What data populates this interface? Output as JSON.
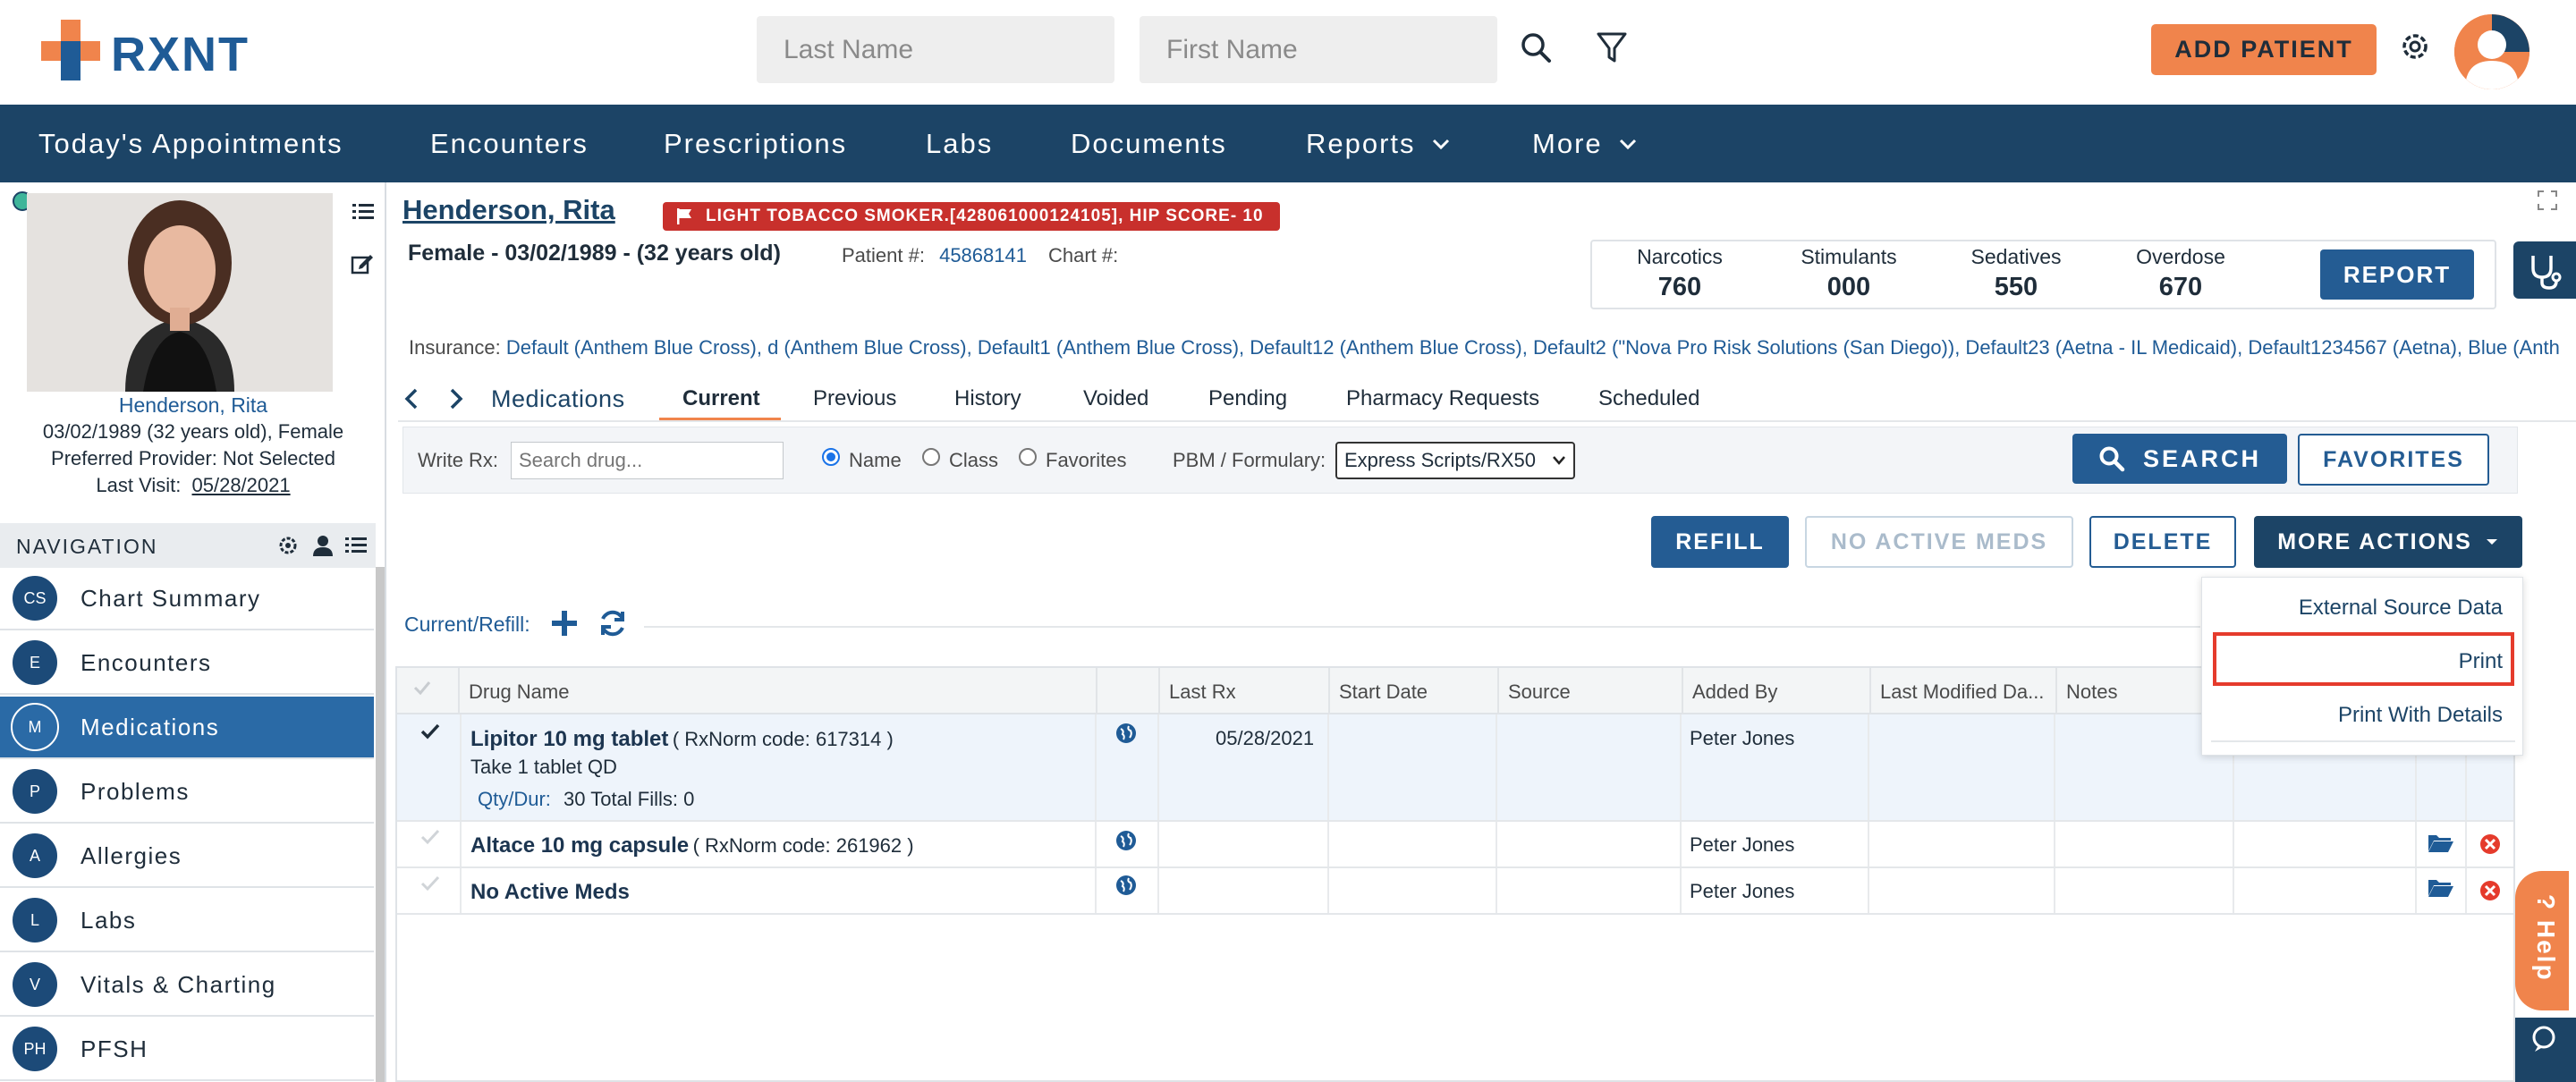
{
  "header": {
    "logo_text": "RXNT",
    "last_name_placeholder": "Last Name",
    "first_name_placeholder": "First Name",
    "add_patient_label": "ADD PATIENT"
  },
  "main_nav": {
    "items": [
      "Today's Appointments",
      "Encounters",
      "Prescriptions",
      "Labs",
      "Documents",
      "Reports",
      "More"
    ]
  },
  "patient": {
    "name": "Henderson, Rita",
    "flag_badge": "LIGHT TOBACCO SMOKER.[428061000124105], HIP SCORE- 10",
    "demographics": "Female - 03/02/1989 - (32 years old)",
    "patient_num_label": "Patient #:",
    "patient_num": "45868141",
    "chart_num_label": "Chart #:",
    "side_name": "Henderson, Rita",
    "side_dob": "03/02/1989 (32 years old), Female",
    "side_provider": "Preferred Provider: Not Selected",
    "side_last_visit_label": "Last Visit:",
    "side_last_visit": "05/28/2021",
    "insurance_label": "Insurance:",
    "insurance_value": "Default (Anthem Blue Cross), d (Anthem Blue Cross), Default1 (Anthem Blue Cross), Default12 (Anthem Blue Cross), Default2 (\"Nova Pro Risk Solutions (San Diego)), Default23 (Aetna - IL Medicaid), Default1234567 (Aetna), Blue (Anth"
  },
  "pdmp": {
    "narcotics_label": "Narcotics",
    "narcotics_value": "760",
    "stimulants_label": "Stimulants",
    "stimulants_value": "000",
    "sedatives_label": "Sedatives",
    "sedatives_value": "550",
    "overdose_label": "Overdose",
    "overdose_value": "670",
    "report_label": "REPORT"
  },
  "side_nav": {
    "title": "NAVIGATION",
    "items": [
      {
        "abbr": "CS",
        "label": "Chart Summary"
      },
      {
        "abbr": "E",
        "label": "Encounters"
      },
      {
        "abbr": "M",
        "label": "Medications"
      },
      {
        "abbr": "P",
        "label": "Problems"
      },
      {
        "abbr": "A",
        "label": "Allergies"
      },
      {
        "abbr": "L",
        "label": "Labs"
      },
      {
        "abbr": "V",
        "label": "Vitals & Charting"
      },
      {
        "abbr": "PH",
        "label": "PFSH"
      }
    ]
  },
  "tabs": {
    "section_title": "Medications",
    "items": [
      "Current",
      "Previous",
      "History",
      "Voided",
      "Pending",
      "Pharmacy Requests",
      "Scheduled"
    ]
  },
  "write_rx": {
    "label": "Write Rx:",
    "search_placeholder": "Search drug...",
    "radio_name": "Name",
    "radio_class": "Class",
    "radio_favorites": "Favorites",
    "pbm_label": "PBM / Formulary:",
    "pbm_value": "Express Scripts/RX50",
    "search_label": "SEARCH",
    "favorites_label": "FAVORITES"
  },
  "actions": {
    "refill": "REFILL",
    "no_active_meds": "NO ACTIVE MEDS",
    "delete": "DELETE",
    "more_actions": "MORE ACTIONS"
  },
  "current_refill_label": "Current/Refill:",
  "table": {
    "headers": [
      "Drug Name",
      "Last Rx",
      "Start Date",
      "Source",
      "Added By",
      "Last Modified Da...",
      "Notes"
    ],
    "rows": [
      {
        "name": "Lipitor 10 mg tablet",
        "rxnorm": "( RxNorm code: 617314 )",
        "sig": "Take 1 tablet QD",
        "qty_label": "Qty/Dur:",
        "qty": "30 Total Fills: 0",
        "last_rx": "05/28/2021",
        "added_by": "Peter Jones"
      },
      {
        "name": "Altace 10 mg capsule",
        "rxnorm": "( RxNorm code: 261962 )",
        "added_by": "Peter Jones"
      },
      {
        "name": "No Active Meds",
        "added_by": "Peter Jones"
      }
    ]
  },
  "more_actions_menu": {
    "items": [
      "External Source Data",
      "Print",
      "Print With Details"
    ]
  },
  "help_label": "Help",
  "colors": {
    "brand_navy": "#1c4466",
    "brand_blue": "#245c93",
    "accent_orange": "#f0844c",
    "flag_red": "#c8302c"
  }
}
